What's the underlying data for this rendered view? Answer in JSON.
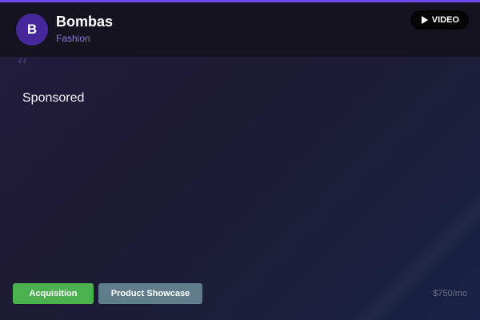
{
  "brand": {
    "initial": "B",
    "name": "Bombas",
    "category": "Fashion"
  },
  "badge": {
    "icon": "play-icon",
    "label": "VIDEO"
  },
  "quote_mark": "“",
  "caption": "Sponsored",
  "tags": [
    {
      "label": "Acquisition",
      "color": "#4caf50"
    },
    {
      "label": "Product Showcase",
      "color": "#607d8b"
    }
  ],
  "price": "$750/mo",
  "colors": {
    "accent": "#6c4cf0",
    "avatar": "#45279a",
    "category_text": "#8e78e8"
  }
}
